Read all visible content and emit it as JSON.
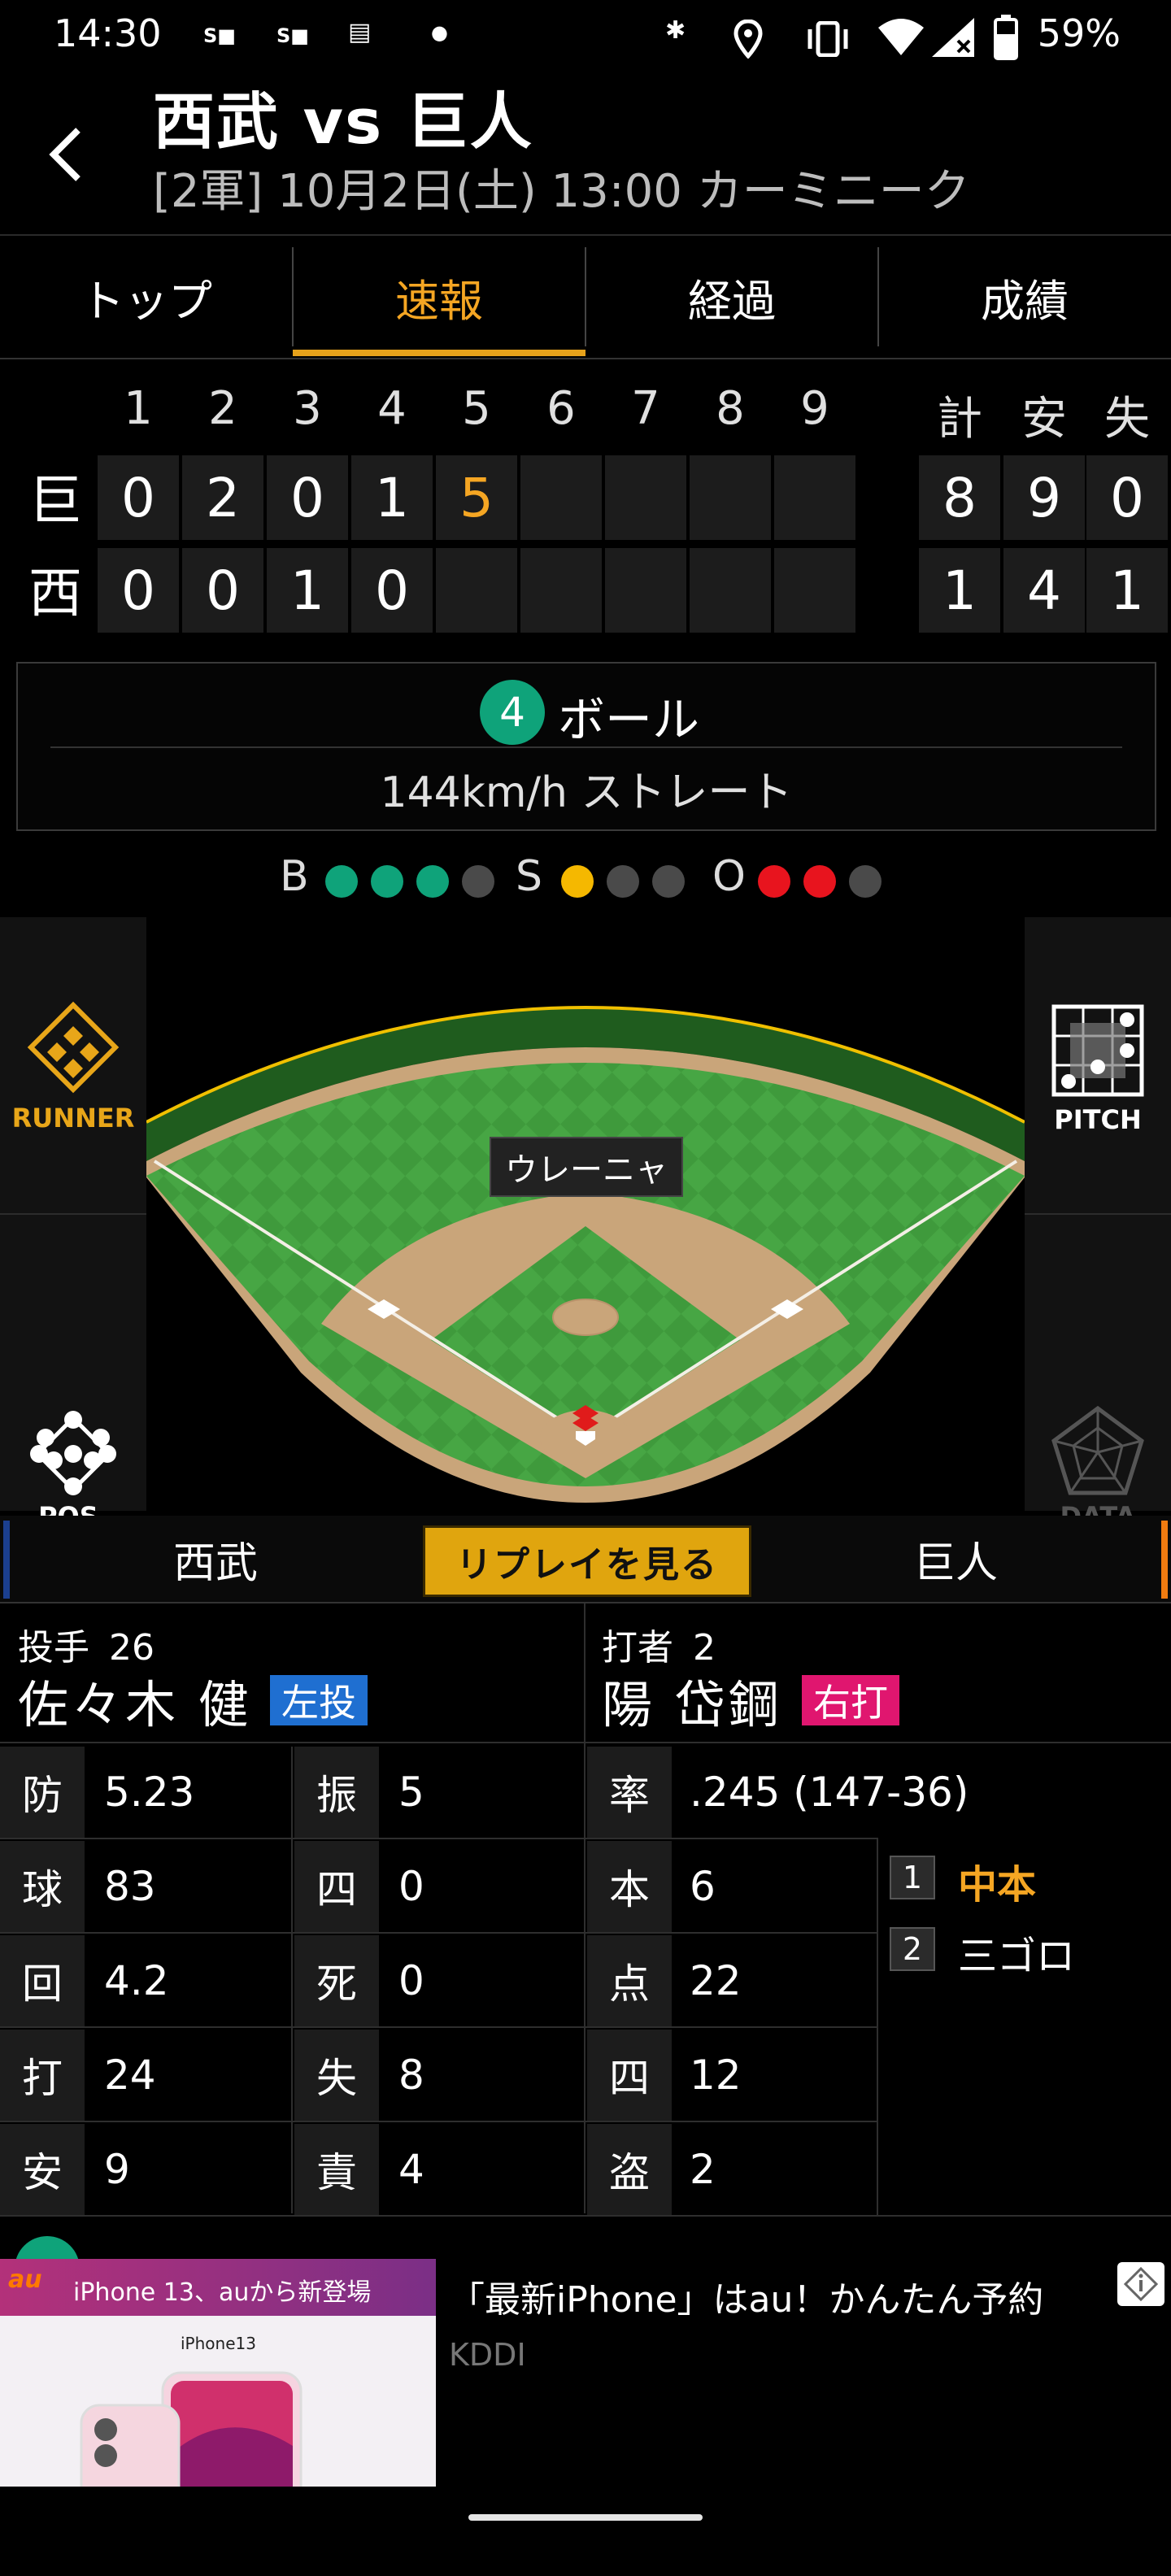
{
  "status_bar": {
    "time": "14:30",
    "battery": "59%",
    "icons": [
      "sports-navi-icon",
      "sports-navi-icon",
      "news-icon",
      "dot-icon",
      "bluetooth-icon",
      "location-icon",
      "vibrate-icon",
      "wifi-icon",
      "signal-icon",
      "battery-icon"
    ]
  },
  "header": {
    "title": "西武 vs 巨人",
    "subtitle": "[2軍] 10月2日(土) 13:00 カーミニーク"
  },
  "tabs": [
    {
      "label": "トップ"
    },
    {
      "label": "速報"
    },
    {
      "label": "経過"
    },
    {
      "label": "成績"
    }
  ],
  "scoreboard": {
    "innings": [
      "1",
      "2",
      "3",
      "4",
      "5",
      "6",
      "7",
      "8",
      "9"
    ],
    "totals_headers": [
      "計",
      "安",
      "失"
    ],
    "rows": [
      {
        "team": "巨",
        "scores": [
          "0",
          "2",
          "0",
          "1",
          "5",
          "",
          "",
          "",
          ""
        ],
        "totals": [
          "8",
          "9",
          "0"
        ]
      },
      {
        "team": "西",
        "scores": [
          "0",
          "0",
          "1",
          "0",
          "",
          "",
          "",
          "",
          ""
        ],
        "totals": [
          "1",
          "4",
          "1"
        ]
      }
    ]
  },
  "pitch": {
    "number": "4",
    "result": "ボール",
    "detail": "144km/h ストレート"
  },
  "count": {
    "b_label": "B",
    "s_label": "S",
    "o_label": "O",
    "balls": 3,
    "balls_max": 4,
    "strikes": 1,
    "strikes_max": 3,
    "outs": 2,
    "outs_max": 3
  },
  "field": {
    "pitcher_name": "ウレーニャ"
  },
  "side_buttons": {
    "runner": "RUNNER",
    "pos": "POS.",
    "pitch": "PITCH",
    "data": "DATA"
  },
  "team_tabs": {
    "left": "西武",
    "replay": "リプレイを見る",
    "right": "巨人"
  },
  "pitcher": {
    "role_label": "投手",
    "number": "26",
    "name": "佐々木 健",
    "hand": "左投",
    "stats": [
      {
        "label": "防",
        "value": "5.23"
      },
      {
        "label": "振",
        "value": "5"
      },
      {
        "label": "球",
        "value": "83"
      },
      {
        "label": "四",
        "value": "0"
      },
      {
        "label": "回",
        "value": "4.2"
      },
      {
        "label": "死",
        "value": "0"
      },
      {
        "label": "打",
        "value": "24"
      },
      {
        "label": "失",
        "value": "8"
      },
      {
        "label": "安",
        "value": "9"
      },
      {
        "label": "責",
        "value": "4"
      }
    ]
  },
  "batter": {
    "role_label": "打者",
    "number": "2",
    "name": "陽 岱鋼",
    "hand": "右打",
    "stats": [
      {
        "label": "率",
        "value": ".245 (147-36)"
      },
      {
        "label": "本",
        "value": "6"
      },
      {
        "label": "点",
        "value": "22"
      },
      {
        "label": "四",
        "value": "12"
      },
      {
        "label": "盗",
        "value": "2"
      }
    ],
    "at_bats": [
      {
        "num": "1",
        "result": "中本"
      },
      {
        "num": "2",
        "result": "三ゴロ"
      }
    ]
  },
  "ad": {
    "banner_text": "iPhone 13、auから新登場",
    "brand": "au",
    "product": "iPhone13",
    "headline": "「最新iPhone」はau！かんたん予約",
    "advertiser": "KDDI"
  },
  "colors": {
    "accent": "#f5a623",
    "ball": "#0fa37a",
    "strike": "#f5b800",
    "out": "#e8141e",
    "left_hand": "#1f6fd1",
    "right_hand": "#e0166f"
  }
}
